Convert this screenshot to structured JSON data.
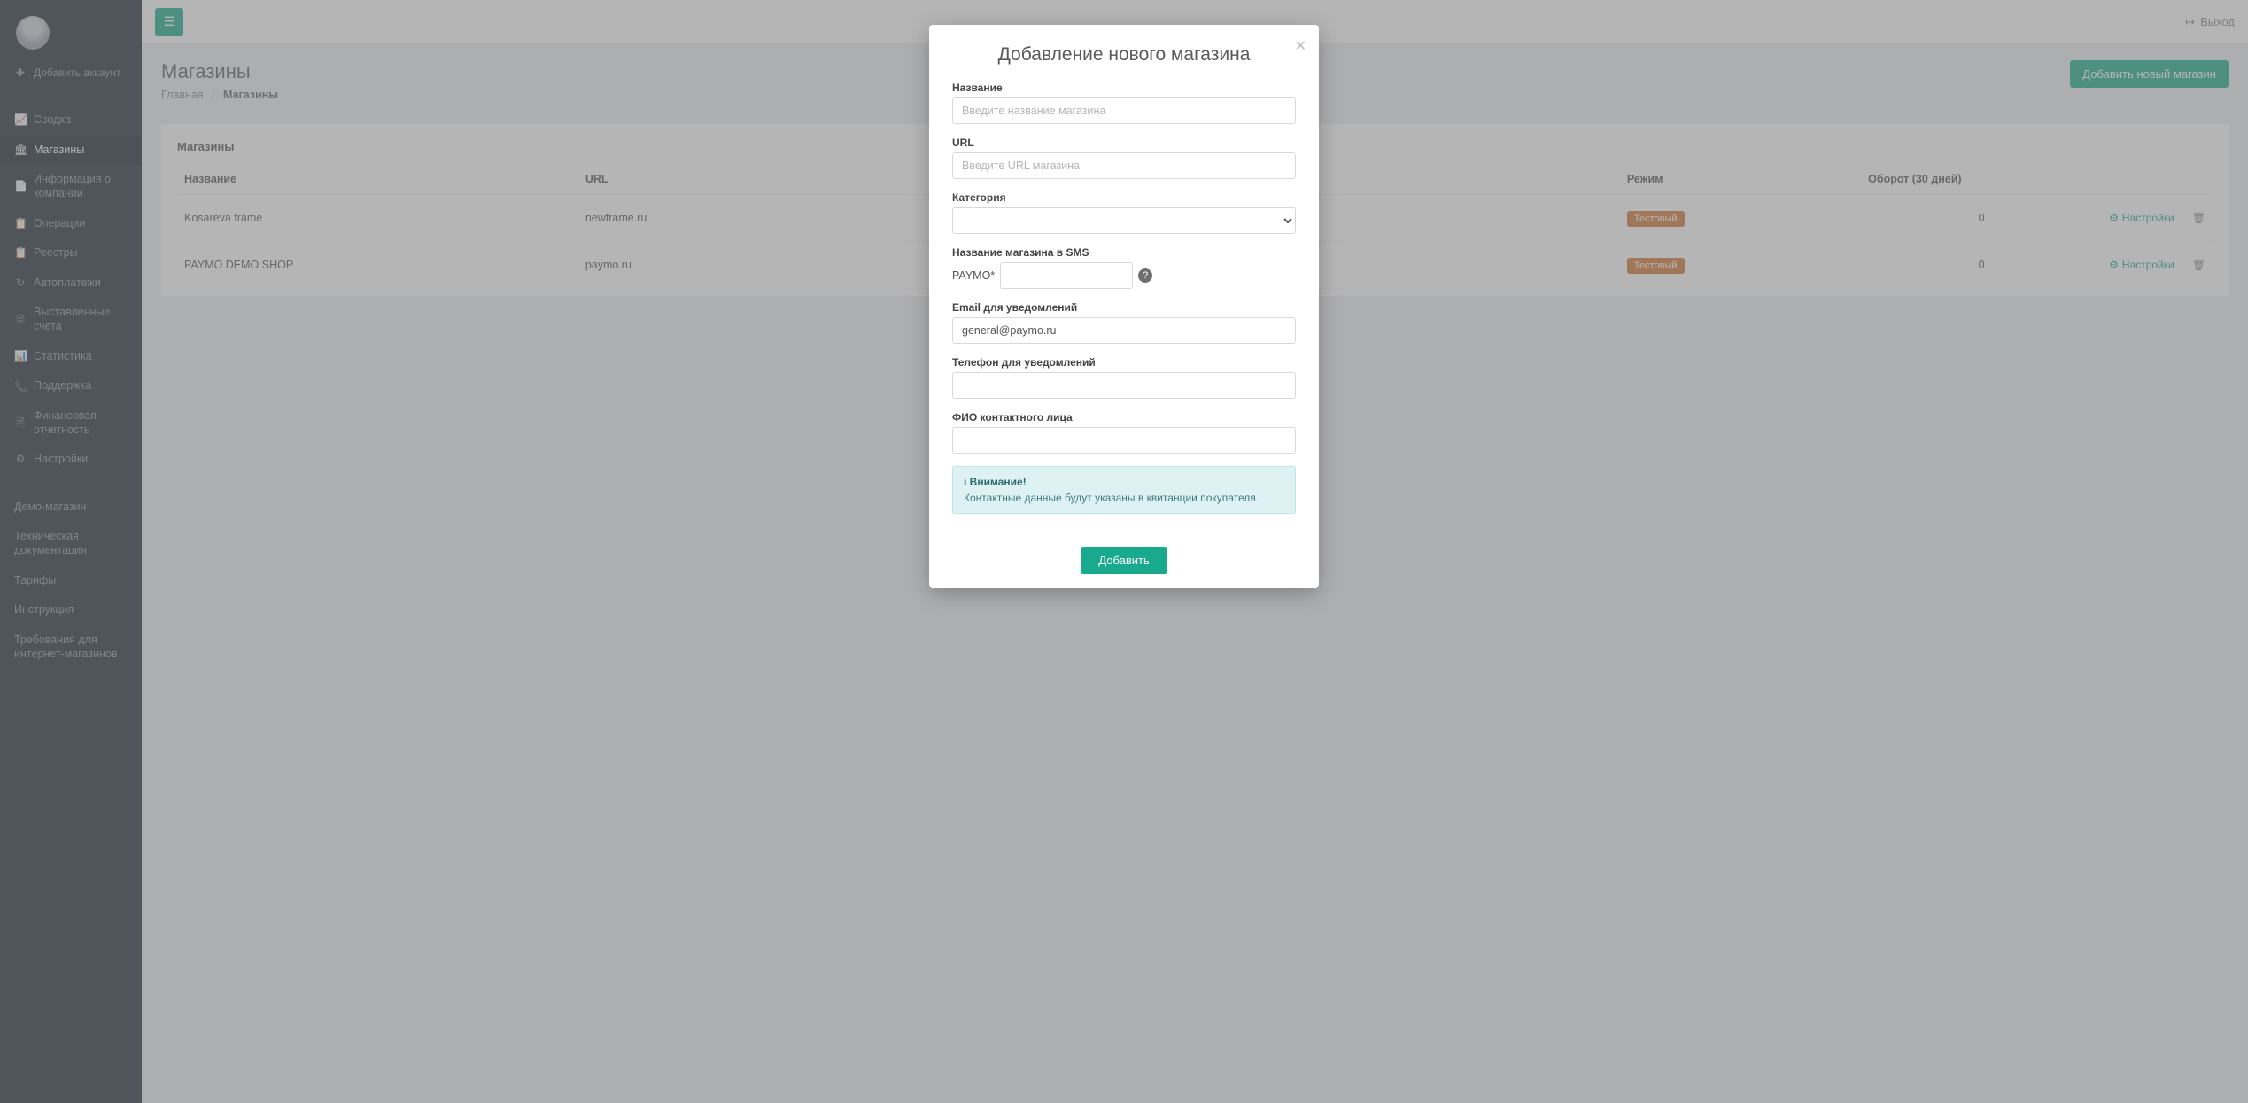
{
  "sidebar": {
    "add_account": "Добавить аккаунт",
    "items": [
      {
        "label": "Сводка",
        "icon": "📈"
      },
      {
        "label": "Магазины",
        "icon": "🏛",
        "active": true
      },
      {
        "label": "Информация о компании",
        "icon": "📄"
      },
      {
        "label": "Операции",
        "icon": "📋"
      },
      {
        "label": "Реестры",
        "icon": "📋"
      },
      {
        "label": "Автоплатежи",
        "icon": "↻"
      },
      {
        "label": "Выставленные счета",
        "icon": "🗎"
      },
      {
        "label": "Статистика",
        "icon": "📊"
      },
      {
        "label": "Поддержка",
        "icon": "📞"
      },
      {
        "label": "Финансовая отчетность",
        "icon": "🗎"
      },
      {
        "label": "Настройки",
        "icon": "⚙"
      }
    ],
    "links": [
      {
        "label": "Демо-магазин"
      },
      {
        "label": "Техническая документация"
      },
      {
        "label": "Тарифы"
      },
      {
        "label": "Инструкция"
      },
      {
        "label": "Требования для интернет-магазинов"
      }
    ]
  },
  "topbar": {
    "logout": "Выход"
  },
  "page": {
    "title": "Магазины",
    "breadcrumb_home": "Главная",
    "breadcrumb_current": "Магазины",
    "add_shop_button": "Добавить новый магазин"
  },
  "table": {
    "card_title": "Магазины",
    "headers": {
      "name": "Название",
      "url": "URL",
      "status": "",
      "mode": "Режим",
      "turnover": "Оборот (30 дней)",
      "actions": ""
    },
    "mode_badge": "Тестовый",
    "settings_label": "Настройки",
    "rows": [
      {
        "name": "Kosareva frame",
        "url": "newframe.ru",
        "turnover": "0"
      },
      {
        "name": "PAYMO DEMO SHOP",
        "url": "paymo.ru",
        "turnover": "0"
      }
    ]
  },
  "modal": {
    "title": "Добавление нового магазина",
    "labels": {
      "name": "Название",
      "url": "URL",
      "category": "Категория",
      "sms_name": "Название магазина в SMS",
      "email": "Email для уведомлений",
      "phone": "Телефон для уведомлений",
      "contact_name": "ФИО контактного лица"
    },
    "placeholders": {
      "name": "Введите название магазина",
      "url": "Введите URL магазина"
    },
    "values": {
      "category_selected": "---------",
      "sms_prefix": "PAYMO*",
      "email": "general@paymo.ru"
    },
    "alert_title": "i Внимание!",
    "alert_text": "Контактные данные будут указаны в квитанции покупателя.",
    "submit": "Добавить"
  }
}
